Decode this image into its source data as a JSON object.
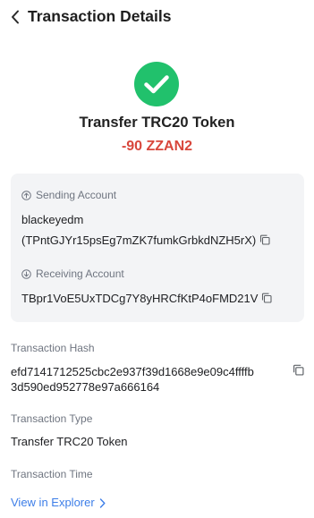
{
  "header": {
    "title": "Transaction Details"
  },
  "summary": {
    "status_icon": "check-circle-icon",
    "tx_name": "Transfer TRC20 Token",
    "amount": "-90 ZZAN2"
  },
  "accounts": {
    "sending_label": "Sending Account",
    "sending_name": "blackeyedm",
    "sending_address": "(TPntGJYr15psEg7mZK7fumkGrbkdNZH5rX)",
    "receiving_label": "Receiving Account",
    "receiving_address": "TBpr1VoE5UxTDCg7Y8yHRCfKtP4oFMD21V"
  },
  "details": {
    "hash_label": "Transaction Hash",
    "hash_line1": "efd7141712525cbc2e937f39d1668e9e09c4ffffb",
    "hash_line2": "3d590ed952778e97a666164",
    "type_label": "Transaction Type",
    "type_value": "Transfer TRC20 Token",
    "time_label": "Transaction Time"
  },
  "footer": {
    "explorer_link": "View in Explorer"
  },
  "colors": {
    "success": "#21c16c",
    "amount_negative": "#d8473c",
    "link": "#3d7ee8",
    "card_bg": "#f3f4f6"
  }
}
